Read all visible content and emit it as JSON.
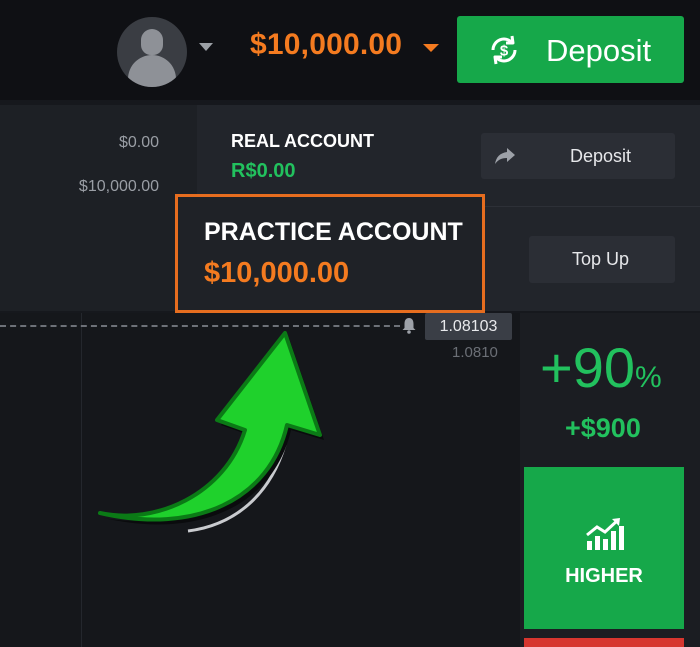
{
  "header": {
    "balance": "$10,000.00",
    "deposit_label": "Deposit",
    "icons": {
      "avatar": "user-avatar-icon",
      "deposit": "currency-exchange-icon"
    }
  },
  "left_column": {
    "value_1": "$0.00",
    "value_2": "$10,000.00"
  },
  "accounts": {
    "real": {
      "title": "REAL ACCOUNT",
      "balance": "R$0.00",
      "button_label": "Deposit"
    },
    "practice": {
      "title": "PRACTICE ACCOUNT",
      "balance": "$10,000.00",
      "button_label": "Top Up"
    }
  },
  "chart": {
    "current_price": "1.08103",
    "axis_price": "1.0810"
  },
  "trade": {
    "payout_percent": "+90",
    "payout_sign": "%",
    "profit": "+$900",
    "higher_label": "HIGHER"
  },
  "colors": {
    "accent_orange": "#f47b20",
    "green": "#16a84a",
    "profit_green": "#22c15e",
    "background": "#16181d"
  }
}
